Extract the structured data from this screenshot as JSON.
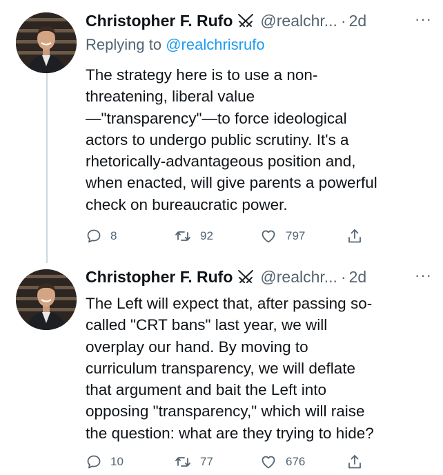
{
  "tweets": [
    {
      "author_name": "Christopher F. Rufo",
      "handle": "@realchr...",
      "dot": "·",
      "time": "2d",
      "more": "···",
      "replying_prefix": "Replying to",
      "replying_handle": "@realchrisrufo",
      "text_lines": [
        "The strategy here is to use a non-",
        "threatening, liberal value",
        "—\"transparency\"—to force ideological",
        "actors to undergo public scrutiny. It's a",
        "rhetorically-advantageous position and,",
        "when enacted, will give parents a powerful",
        "check on bureaucratic power."
      ],
      "reply_count": "8",
      "retweet_count": "92",
      "like_count": "797"
    },
    {
      "author_name": "Christopher F. Rufo",
      "handle": "@realchr...",
      "dot": "·",
      "time": "2d",
      "more": "···",
      "text_lines": [
        "The Left will expect that, after passing so-",
        "called \"CRT bans\" last year, we will",
        "overplay our hand. By moving to",
        "curriculum transparency, we will deflate",
        "that argument and bait the Left into",
        "opposing \"transparency,\" which will raise",
        "the question: what are they trying to hide?"
      ],
      "reply_count": "10",
      "retweet_count": "77",
      "like_count": "676"
    }
  ],
  "icons": {
    "badge": "crossed-swords-icon",
    "reply": "comment-icon",
    "retweet": "retweet-icon",
    "like": "heart-icon",
    "share": "share-icon"
  },
  "colors": {
    "text": "#0f1419",
    "secondary": "#536471",
    "link": "#1d9bf0",
    "thread_line": "#cfd9de"
  }
}
